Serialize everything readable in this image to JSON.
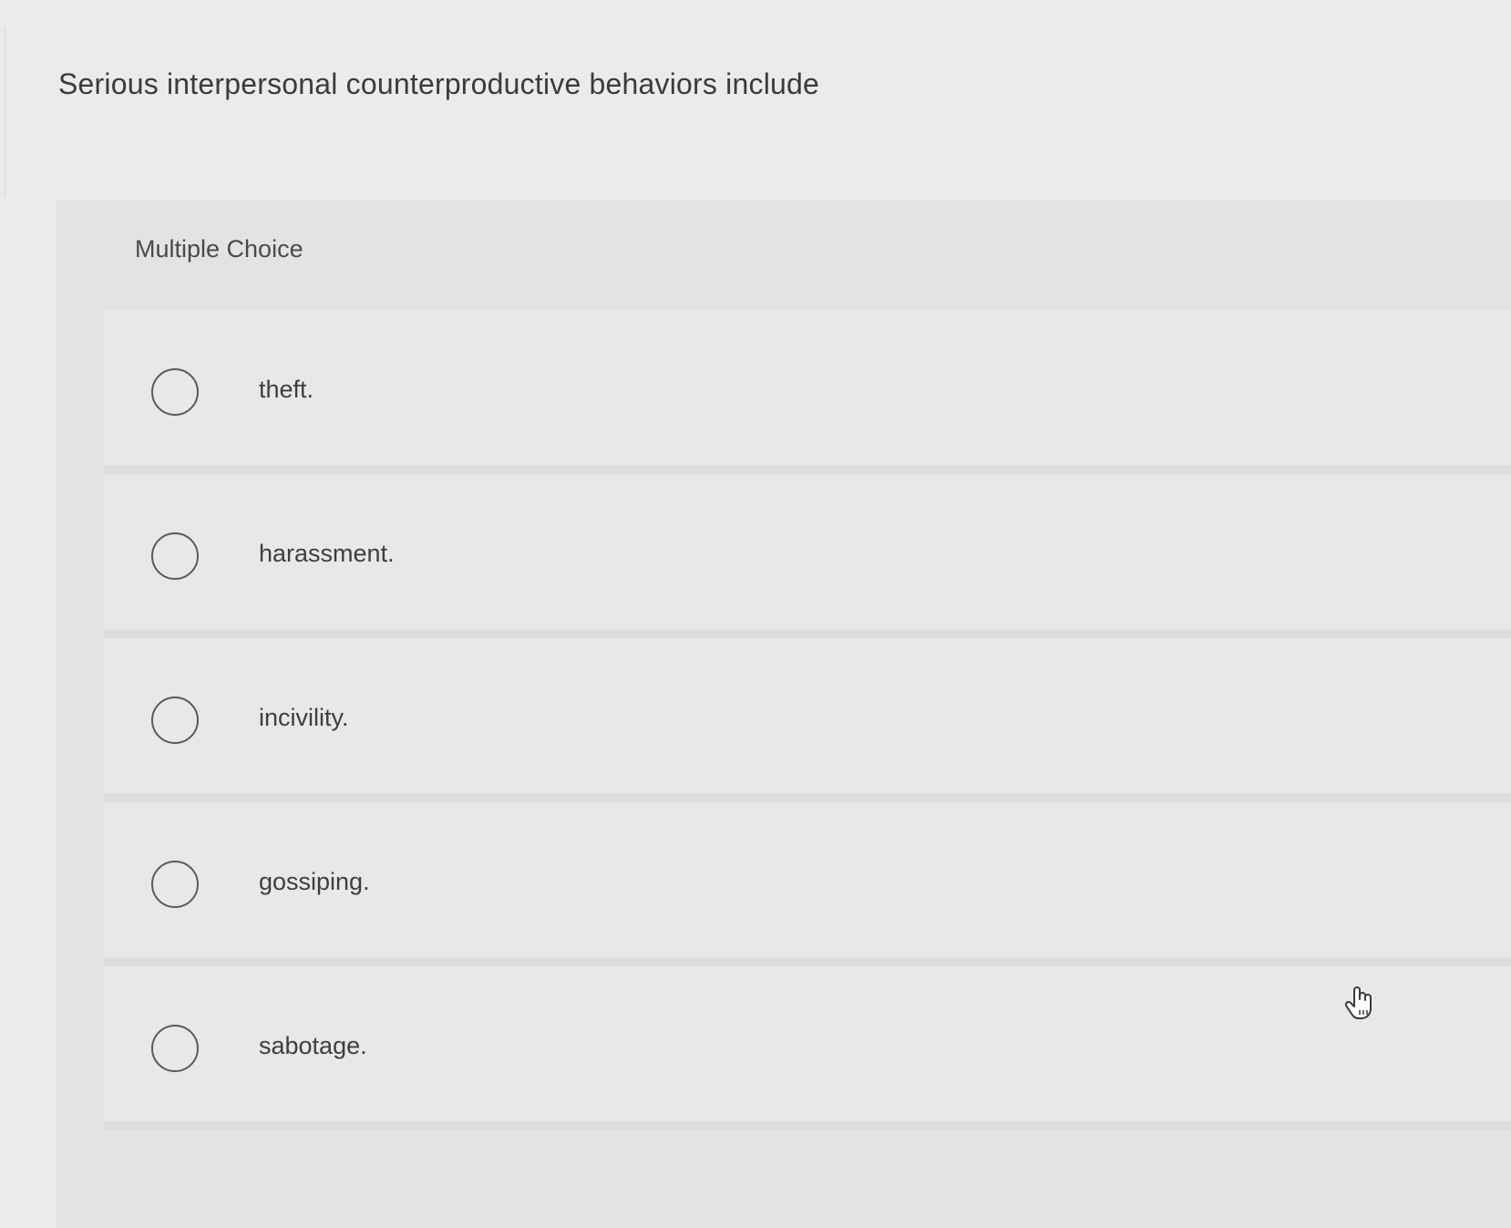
{
  "question": {
    "text": "Serious interpersonal counterproductive behaviors include"
  },
  "panel": {
    "label": "Multiple Choice"
  },
  "choices": [
    {
      "label": "theft.",
      "selected": false
    },
    {
      "label": "harassment.",
      "selected": false
    },
    {
      "label": "incivility.",
      "selected": false
    },
    {
      "label": "gossiping.",
      "selected": false
    },
    {
      "label": "sabotage.",
      "selected": false
    }
  ],
  "cursor": {
    "icon": "hand-pointer-icon"
  }
}
